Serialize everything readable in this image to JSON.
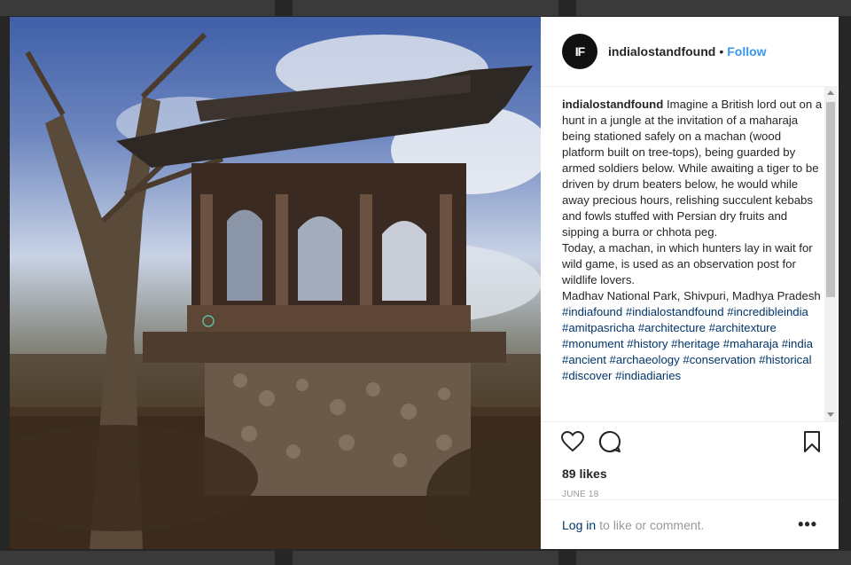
{
  "post": {
    "username": "indialostandfound",
    "avatar_text": "IF",
    "separator": "•",
    "follow_label": "Follow",
    "caption_user": "indialostandfound",
    "caption_text": "Imagine a British lord out on a hunt in a jungle at the invitation of a maharaja being stationed safely on a machan (wood platform built on tree-tops), being guarded by armed soldiers below. While awaiting a tiger to be driven by drum beaters below, he would while away precious hours, relishing succulent kebabs and fowls stuffed with Persian dry fruits and sipping a burra or chhota peg.",
    "caption_text2": "Today, a machan, in which hunters lay in wait for wild game, is used as an observation post for wildlife lovers.",
    "caption_location": "Madhav National Park, Shivpuri, Madhya Pradesh",
    "hashtags": "#indiafound #indialostandfound #incredibleindia #amitpasricha #architecture #architexture #monument #history #heritage #maharaja #india #ancient #archaeology #conservation #historical #discover #indiadiaries",
    "likes": "89 likes",
    "date": "JUNE 18",
    "login_label": "Log in",
    "comment_prompt": "to like or comment.",
    "more_label": "•••"
  },
  "icons": {
    "like": "heart-icon",
    "comment": "comment-icon",
    "save": "bookmark-icon",
    "more": "more-options-icon"
  },
  "colors": {
    "link": "#3897f0",
    "hashtag": "#003569",
    "text": "#262626",
    "muted": "#999999"
  }
}
